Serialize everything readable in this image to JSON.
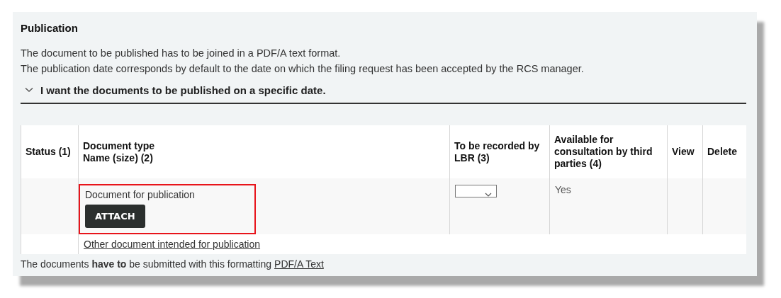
{
  "section": {
    "title": "Publication",
    "description": [
      "The document to be published has to be joined in a PDF/A text format.",
      "The publication date corresponds by default to the date on which the filing request has been accepted by the RCS manager."
    ],
    "accordion": {
      "label": "I want the documents to be published on a specific date.",
      "expanded": false
    }
  },
  "table": {
    "columns": [
      "Status (1)",
      "Document type\nName (size) (2)",
      "To be recorded by LBR (3)",
      "Available for consultation by third parties (4)",
      "View",
      "Delete"
    ],
    "rows": [
      {
        "document_type": "Document for publication",
        "button": "ATTACH",
        "highlighted": true,
        "available": "Yes"
      }
    ],
    "extra_link": "Other document intended for publication"
  },
  "footer": {
    "text": "The documents **have to** be submitted with this formatting",
    "link": "PDF/A Text"
  }
}
